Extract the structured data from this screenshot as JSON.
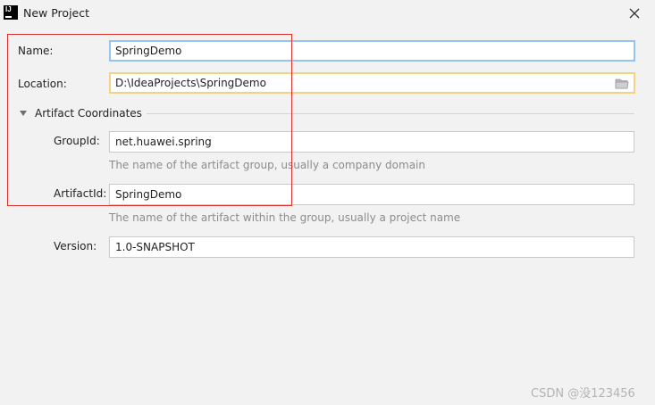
{
  "window": {
    "title": "New Project",
    "app_icon_text": "IJ",
    "close_icon": "close-icon"
  },
  "form": {
    "name": {
      "label": "Name:",
      "value": "SpringDemo"
    },
    "location": {
      "label": "Location:",
      "value": "D:\\IdeaProjects\\SpringDemo",
      "browse_icon": "folder-icon"
    },
    "artifact_section": {
      "label": "Artifact Coordinates",
      "expanded": true,
      "group_id": {
        "label": "GroupId:",
        "value": "net.huawei.spring",
        "hint": "The name of the artifact group, usually a company domain"
      },
      "artifact_id": {
        "label": "ArtifactId:",
        "value": "SpringDemo",
        "hint": "The name of the artifact within the group, usually a project name"
      },
      "version": {
        "label": "Version:",
        "value": "1.0-SNAPSHOT"
      }
    }
  },
  "colors": {
    "background": "#f2f2f2",
    "focus_border": "#97c3f3",
    "warning_border": "#f4d283",
    "highlight_annotation": "#d9302c"
  },
  "watermark": "CSDN @没123456"
}
